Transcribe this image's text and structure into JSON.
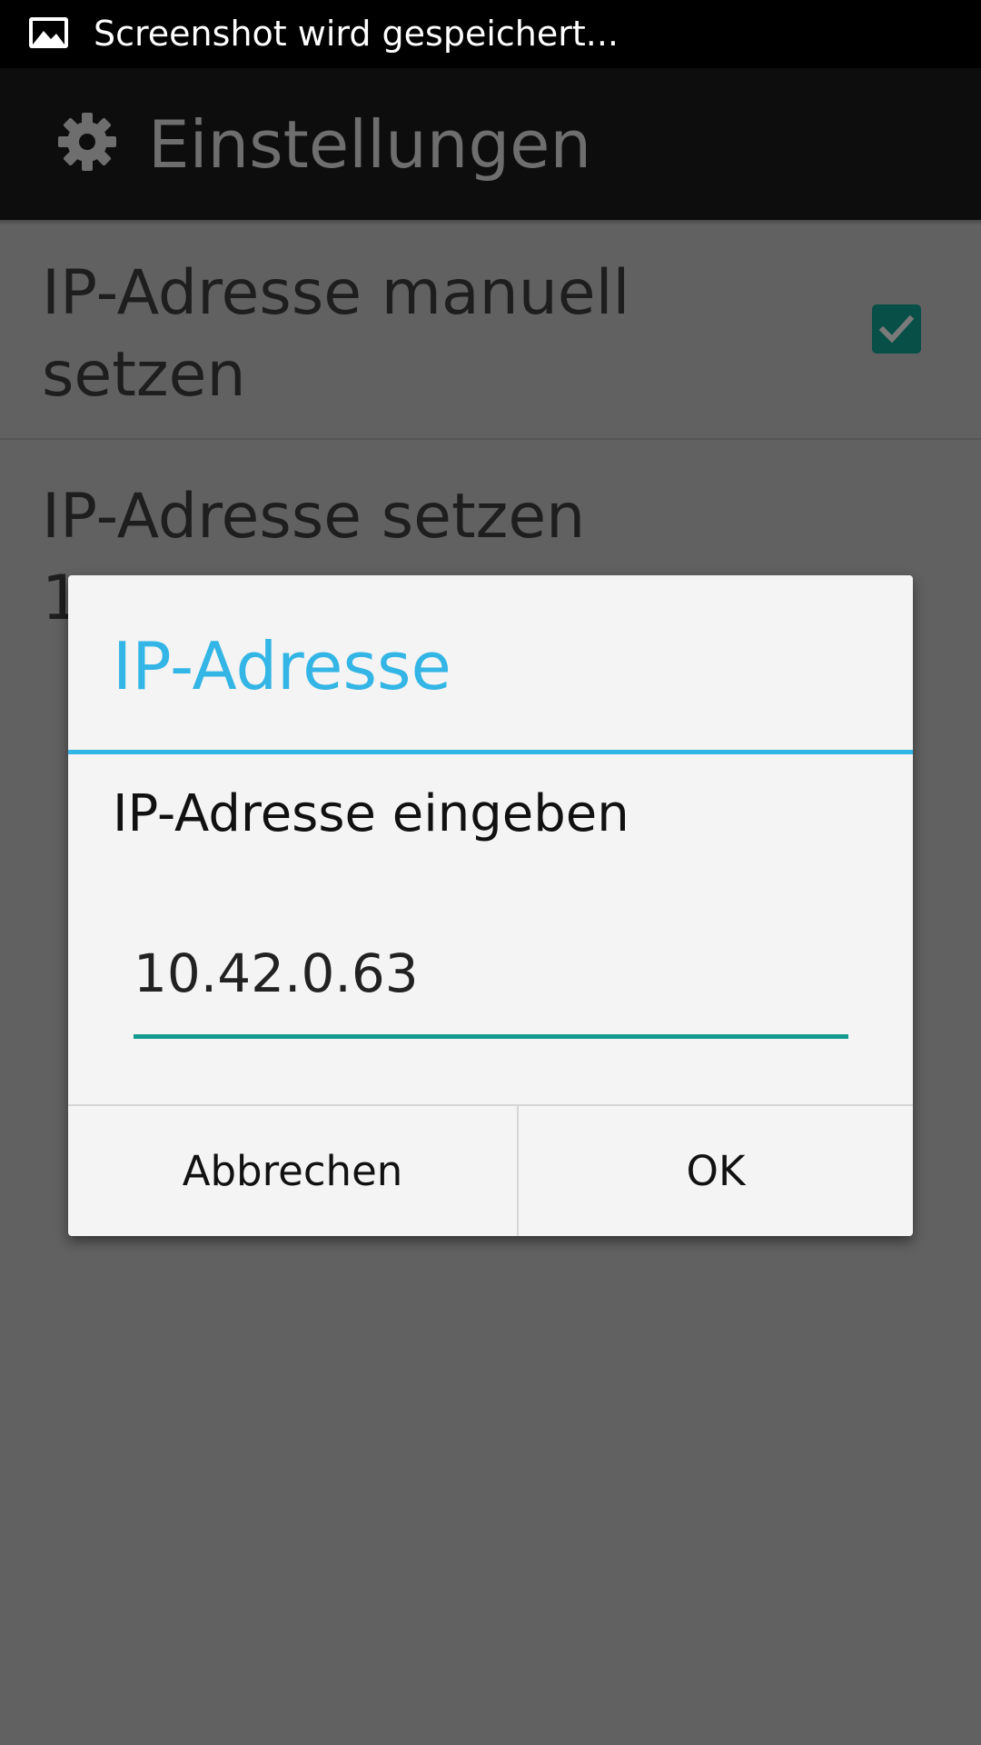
{
  "status_bar": {
    "notification_text": "Screenshot wird gespeichert...",
    "icon": "image-icon"
  },
  "action_bar": {
    "icon": "gear-icon",
    "title": "Einstellungen"
  },
  "preferences": [
    {
      "title": "IP-Adresse manuell setzen",
      "checked": true
    },
    {
      "title": "IP-Adresse setzen",
      "summary": "1"
    }
  ],
  "dialog": {
    "title": "IP-Adresse",
    "message": "IP-Adresse eingeben",
    "input_value": "10.42.0.63",
    "cancel_label": "Abbrechen",
    "ok_label": "OK"
  },
  "colors": {
    "accent_holo_blue": "#33b5e5",
    "input_underline": "#139a90",
    "checkbox": "#074f47"
  }
}
